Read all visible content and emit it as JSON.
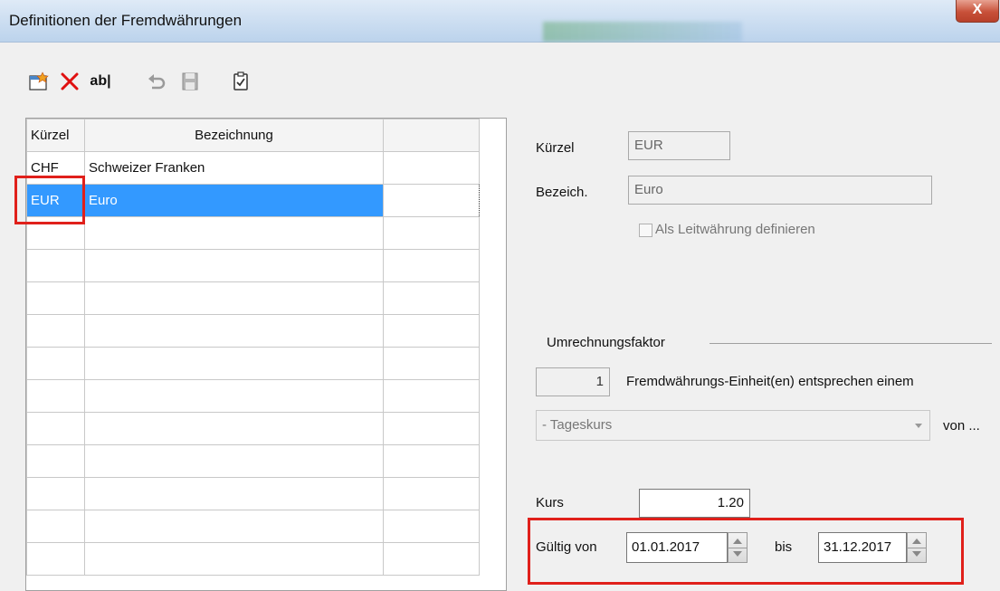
{
  "window": {
    "title": "Definitionen der Fremdwährungen",
    "close_label": "X"
  },
  "toolbar": {
    "icons": [
      "new-record-icon",
      "delete-icon",
      "rename-icon",
      "undo-icon",
      "save-icon",
      "clipboard-check-icon"
    ],
    "rename_label": "ab|"
  },
  "grid": {
    "columns": [
      "Kürzel",
      "Bezeichnung",
      ""
    ],
    "rows": [
      {
        "code": "CHF",
        "name": "Schweizer Franken"
      },
      {
        "code": "EUR",
        "name": "Euro"
      }
    ],
    "selected_row": 1,
    "empty_row_count": 11
  },
  "detail": {
    "code_label": "Kürzel",
    "code_value": "EUR",
    "name_label": "Bezeich.",
    "name_value": "Euro",
    "leit_checkbox_label": "Als Leitwährung definieren",
    "conversion_group": "Umrechnungsfaktor",
    "units_value": "1",
    "units_label": "Fremdwährungs-Einheit(en) entsprechen einem",
    "rate_type_value": "- Tageskurs",
    "von_label": "von ...",
    "rate_label": "Kurs",
    "rate_value": "1.20",
    "valid_from_label": "Gültig von",
    "valid_from_value": "01.01.2017",
    "valid_to_label": "bis",
    "valid_to_value": "31.12.2017"
  },
  "colors": {
    "selection": "#3399ff",
    "highlight": "#e0201b"
  }
}
